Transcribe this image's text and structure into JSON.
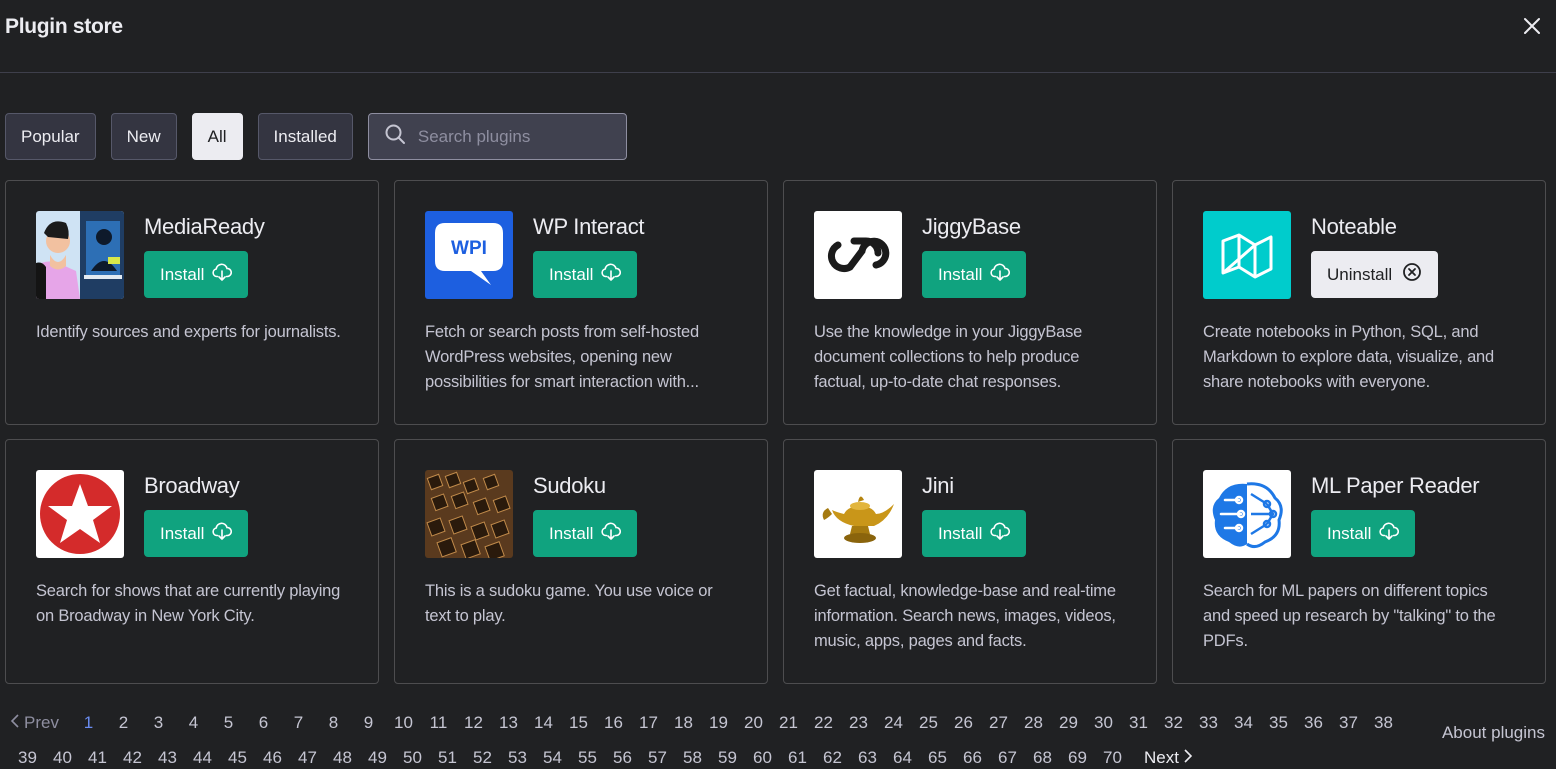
{
  "header": {
    "title": "Plugin store",
    "close_icon": "close-icon"
  },
  "filters": [
    {
      "label": "Popular",
      "active": false
    },
    {
      "label": "New",
      "active": false
    },
    {
      "label": "All",
      "active": true
    },
    {
      "label": "Installed",
      "active": false
    }
  ],
  "search": {
    "placeholder": "Search plugins",
    "value": ""
  },
  "plugins": [
    {
      "name": "MediaReady",
      "action": "Install",
      "description": "Identify sources and experts for journalists.",
      "logo": "mediaready-logo"
    },
    {
      "name": "WP Interact",
      "action": "Install",
      "description": "Fetch or search posts from self-hosted WordPress websites, opening new possibilities for smart interaction with...",
      "logo": "wp-interact-logo",
      "logo_text": "WPI"
    },
    {
      "name": "JiggyBase",
      "action": "Install",
      "description": "Use the knowledge in your JiggyBase document collections to help produce factual, up-to-date chat responses.",
      "logo": "jiggybase-logo"
    },
    {
      "name": "Noteable",
      "action": "Uninstall",
      "description": "Create notebooks in Python, SQL, and Markdown to explore data, visualize, and share notebooks with everyone.",
      "logo": "noteable-logo"
    },
    {
      "name": "Broadway",
      "action": "Install",
      "description": "Search for shows that are currently playing on Broadway in New York City.",
      "logo": "broadway-logo"
    },
    {
      "name": "Sudoku",
      "action": "Install",
      "description": "This is a sudoku game. You use voice or text to play.",
      "logo": "sudoku-logo"
    },
    {
      "name": "Jini",
      "action": "Install",
      "description": "Get factual, knowledge-base and real-time information. Search news, images, videos, music, apps, pages and facts.",
      "logo": "jini-logo"
    },
    {
      "name": "ML Paper Reader",
      "action": "Install",
      "description": "Search for ML papers on different topics and speed up research by \"talking\" to the PDFs.",
      "logo": "ml-paper-reader-logo"
    }
  ],
  "pagination": {
    "prev_label": "Prev",
    "next_label": "Next",
    "current_page": "1",
    "row1": [
      "1",
      "2",
      "3",
      "4",
      "5",
      "6",
      "7",
      "8",
      "9",
      "10",
      "11",
      "12",
      "13",
      "14",
      "15",
      "16",
      "17",
      "18",
      "19",
      "20",
      "21",
      "22",
      "23",
      "24",
      "25",
      "26",
      "27",
      "28",
      "29",
      "30",
      "31",
      "32",
      "33",
      "34",
      "35",
      "36",
      "37",
      "38"
    ],
    "row2": [
      "39",
      "40",
      "41",
      "42",
      "43",
      "44",
      "45",
      "46",
      "47",
      "48",
      "49",
      "50",
      "51",
      "52",
      "53",
      "54",
      "55",
      "56",
      "57",
      "58",
      "59",
      "60",
      "61",
      "62",
      "63",
      "64",
      "65",
      "66",
      "67",
      "68",
      "69",
      "70"
    ]
  },
  "footer": {
    "about_label": "About plugins"
  },
  "colors": {
    "background": "#202123",
    "install_green": "#10a37f",
    "active_page_blue": "#6a8cf0"
  }
}
